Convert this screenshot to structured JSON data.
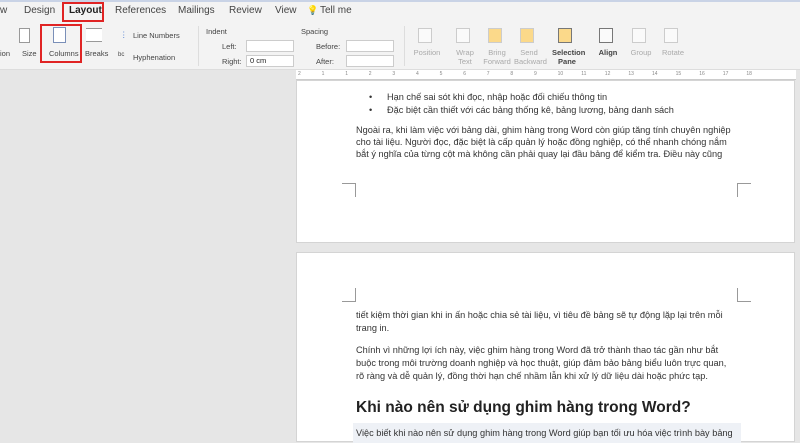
{
  "tabs": [
    {
      "label": "w"
    },
    {
      "label": "Design"
    },
    {
      "label": "Layout",
      "active": true
    },
    {
      "label": "References"
    },
    {
      "label": "Mailings"
    },
    {
      "label": "Review"
    },
    {
      "label": "View"
    },
    {
      "label": "Tell me"
    }
  ],
  "ribbon": {
    "orientation": "ion",
    "size": "Size",
    "columns": "Columns",
    "breaks": "Breaks",
    "line_numbers": "Line Numbers",
    "hyphenation": "Hyphenation",
    "indent": {
      "title": "Indent",
      "left_label": "Left:",
      "left_value": "",
      "right_label": "Right:",
      "right_value": "0 cm"
    },
    "spacing": {
      "title": "Spacing",
      "before_label": "Before:",
      "before_value": "",
      "after_label": "After:",
      "after_value": ""
    },
    "arrange": [
      {
        "l1": "Position",
        "l2": ""
      },
      {
        "l1": "Wrap",
        "l2": "Text"
      },
      {
        "l1": "Bring",
        "l2": "Forward"
      },
      {
        "l1": "Send",
        "l2": "Backward"
      },
      {
        "l1": "Selection",
        "l2": "Pane",
        "enabled": true
      },
      {
        "l1": "Align",
        "l2": "",
        "enabled": true
      },
      {
        "l1": "Group",
        "l2": ""
      },
      {
        "l1": "Rotate",
        "l2": ""
      }
    ]
  },
  "ruler": [
    "2",
    "1",
    "1",
    "2",
    "3",
    "4",
    "5",
    "6",
    "7",
    "8",
    "9",
    "10",
    "11",
    "12",
    "13",
    "14",
    "15",
    "16",
    "17",
    "18"
  ],
  "highlight_color": "#e02424",
  "page1": {
    "bullets": [
      "Hạn chế sai sót khi đọc, nhập hoặc đối chiếu thông tin",
      "Đặc biệt cần thiết với các bảng thống kê, bảng lương, bảng danh sách"
    ],
    "para": [
      "Ngoài ra, khi làm việc với bảng dài, ghim hàng trong Word còn giúp tăng tính chuyên nghiệp",
      "cho tài liệu. Người đọc, đặc biệt là cấp quản lý hoặc đồng nghiệp, có thể nhanh chóng nắm",
      "bắt ý nghĩa của từng cột mà không cần phải quay lại đầu bảng để kiểm tra. Điều này cũng"
    ]
  },
  "page2": {
    "para1": [
      "tiết kiệm thời gian khi in ấn hoặc chia sẻ tài liệu, vì tiêu đề bảng sẽ tự động lặp lại trên mỗi",
      "trang in."
    ],
    "para2": [
      "Chính vì những lợi ích này, việc ghim hàng trong Word đã trở thành thao tác gần như bắt",
      "buộc trong môi trường doanh nghiệp và học thuật, giúp đảm bảo bảng biểu luôn trực quan,",
      "rõ ràng và dễ quản lý, đồng thời hạn chế nhầm lẫn khi xử lý dữ liệu dài hoặc phức tạp."
    ],
    "heading": "Khi nào nên sử dụng ghim hàng trong Word?",
    "para3": "Việc biết khi nào nên sử dụng ghim hàng trong Word giúp bạn tối ưu hóa việc trình bày bảng"
  }
}
